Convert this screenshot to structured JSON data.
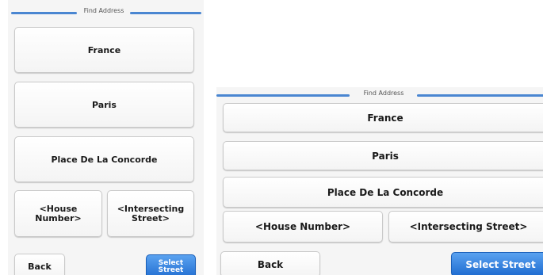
{
  "portrait": {
    "title": "Find Address",
    "country": "France",
    "city": "Paris",
    "street": "Place De La Concorde",
    "house_number": "<House\nNumber>",
    "intersecting_street": "<Intersecting\nStreet>",
    "back": "Back",
    "select_street": "Select\nStreet"
  },
  "landscape": {
    "title": "Find Address",
    "country": "France",
    "city": "Paris",
    "street": "Place De La Concorde",
    "house_number": "<House Number>",
    "intersecting_street": "<Intersecting Street>",
    "back": "Back",
    "select_street": "Select Street"
  },
  "colors": {
    "accent_blue": "#1f6cd0",
    "title_line": "#4a86d1",
    "button_bg": "#ffffff",
    "screen_bg": "#f5f5f5"
  }
}
